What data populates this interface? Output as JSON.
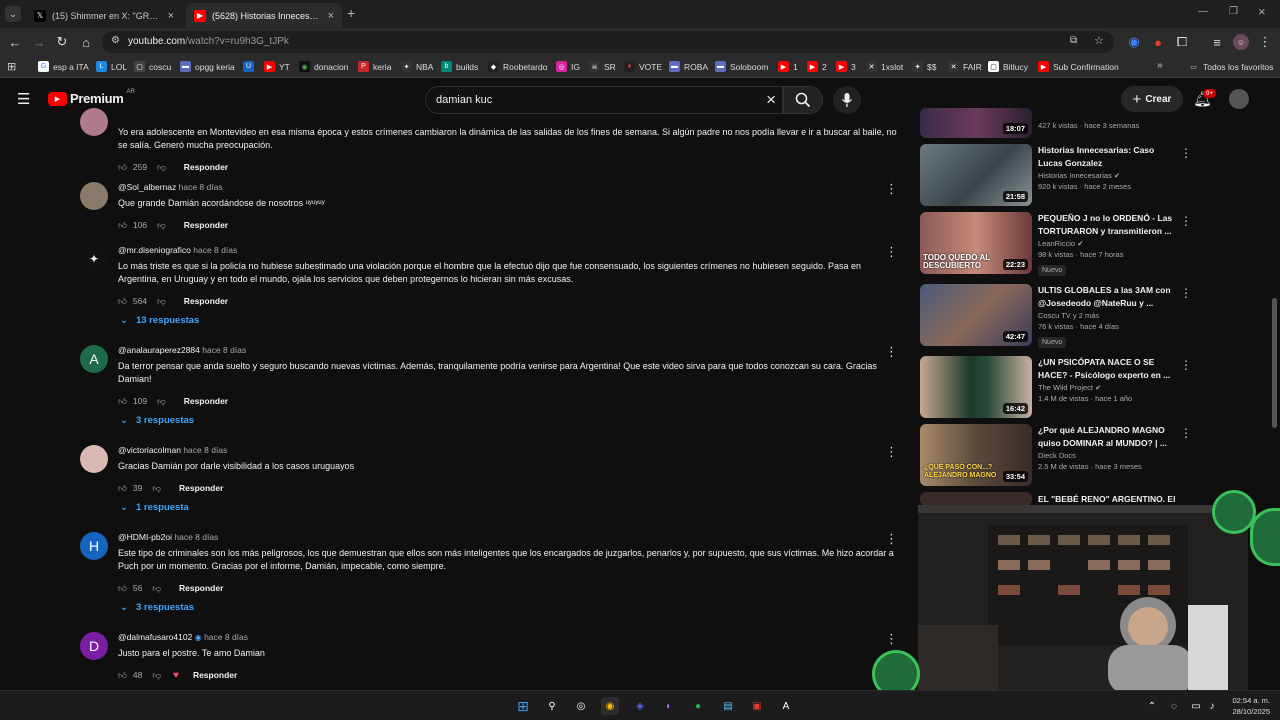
{
  "browser": {
    "tabs": [
      {
        "label": "(15) Shimmer en X: \"GRAVES S...",
        "active": false
      },
      {
        "label": "(5628) Historias Innecesarias: P...",
        "active": true
      }
    ],
    "url_host": "youtube.com",
    "url_path": "/watch?v=ru9h3G_tJPk",
    "bookmarks": [
      "esp a ITA",
      "LOL",
      "coscu",
      "opgg keria",
      "YT",
      "donacion",
      "keria",
      "NBA",
      "builds",
      "Roobetardo",
      "IG",
      "SR",
      "VOTE",
      "ROBA",
      "Soloboom",
      "1",
      "2",
      "3",
      "1xslot",
      "$$",
      "FAIR",
      "Bitlucy",
      "Sub Confirmation"
    ],
    "all_bookmarks": "Todos los favoritos"
  },
  "youtube": {
    "logo": "Premium",
    "region": "AR",
    "search_value": "damian kuc",
    "create_label": "Crear",
    "notif_count": "9+"
  },
  "comments": [
    {
      "author": "",
      "ago": "",
      "text": "Yo era adolescente en Montevideo en esa misma época y estos crímenes cambiaron la dinámica de las salidas de los fines de semana. Si algún padre no nos podía llevar e ir a buscar al baile, no se salía. Generó mucha preocupación.",
      "likes": "259",
      "reply": "Responder",
      "replies": "",
      "initial": ""
    },
    {
      "author": "@Sol_albernaz",
      "ago": "hace 8 días",
      "text": "Que grande Damián acordándose de nosotros ᵘʸᵘʸᵘʸ",
      "likes": "106",
      "reply": "Responder",
      "replies": "",
      "initial": ""
    },
    {
      "author": "@mr.diseniografico",
      "ago": "hace 8 días",
      "text": "Lo más triste es que si la policía no hubiese subestimado una violación porque el hombre que la efectuó dijo que fue consensuado, los siguientes crímenes no hubiesen seguido. Pasa en Argentina, en Uruguay y en todo el mundo, ojala los servicios que deben protegernos lo hicieran sin más excusas.",
      "likes": "564",
      "reply": "Responder",
      "replies": "13 respuestas",
      "initial": ""
    },
    {
      "author": "@analauraperez2884",
      "ago": "hace 8 días",
      "text": "Da terror pensar que anda suelto y seguro buscando nuevas víctimas. Además, tranquilamente podría venirse para Argentina! Que este video sirva para que todos conozcan su cara. Gracias Damian!",
      "likes": "109",
      "reply": "Responder",
      "replies": "3 respuestas",
      "initial": "A"
    },
    {
      "author": "@victoriacolman",
      "ago": "hace 8 días",
      "text": "Gracias Damián por darle visibilidad a los casos uruguayos",
      "likes": "39",
      "reply": "Responder",
      "replies": "1 respuesta",
      "initial": ""
    },
    {
      "author": "@HDMI-pb2oi",
      "ago": "hace 8 días",
      "text": "Este tipo de criminales son los más peligrosos, los que demuestran que ellos son más inteligentes que los encargados de juzgarlos, penarlos y, por supuesto, que sus víctimas. Me hizo acordar a Puch por un momento. Gracias por el informe, Damián, impecable, como siempre.",
      "likes": "56",
      "reply": "Responder",
      "replies": "3 respuestas",
      "initial": "H"
    },
    {
      "author": "@dalmafusaro4102",
      "ago": "hace 8 días",
      "text": "Justo para el postre. Te amo Damian",
      "likes": "48",
      "reply": "Responder",
      "replies": "",
      "initial": "D"
    }
  ],
  "sidebar": [
    {
      "title": "",
      "channel": "",
      "stats": "427 k vistas · hace 3 semanas",
      "duration": "18:07",
      "badge": "",
      "overlay": ""
    },
    {
      "title": "Historias Innecesarias: Caso Lucas Gonzalez",
      "channel": "Historias Innecesarias",
      "stats": "920 k vistas · hace 2 meses",
      "duration": "21:58",
      "badge": "",
      "overlay": ""
    },
    {
      "title": "PEQUEÑO J no lo ORDENÓ - Las TORTURARON y transmitieron ...",
      "channel": "LeanRiccio",
      "stats": "98 k vistas · hace 7 horas",
      "duration": "22:23",
      "badge": "Nuevo",
      "overlay": "TODO QUEDÓ AL DESCUBIERTO"
    },
    {
      "title": "ULTIS GLOBALES a las 3AM con @Josedeodo @NateRuu y ...",
      "channel": "Coscu TV y 2 más",
      "stats": "76 k vistas · hace 4 días",
      "duration": "42:47",
      "badge": "Nuevo",
      "overlay": ""
    },
    {
      "title": "¿UN PSICÓPATA NACE O SE HACE? - Psicólogo experto en ...",
      "channel": "The Wild Project",
      "stats": "1.4 M de vistas · hace 1 año",
      "duration": "16:42",
      "badge": "",
      "overlay": ""
    },
    {
      "title": "¿Por qué ALEJANDRO MAGNO quiso DOMINAR al MUNDO? | ...",
      "channel": "Dieck Docs",
      "stats": "2.5 M de vistas · hace 3 meses",
      "duration": "33:54",
      "badge": "",
      "overlay": "¿QUÉ PASÓ CON...? ALEJANDRO MAGNO"
    },
    {
      "title": "EL \"BEBÉ RENO\" ARGENTINO. El",
      "channel": "",
      "stats": "",
      "duration": "",
      "badge": "",
      "overlay": ""
    }
  ],
  "clock": {
    "time": "02:54 a. m.",
    "date": "28/10/2025"
  },
  "colors": {
    "link": "#3ea6ff",
    "yt_red": "#ff0000",
    "bg": "#0f0f0f"
  }
}
